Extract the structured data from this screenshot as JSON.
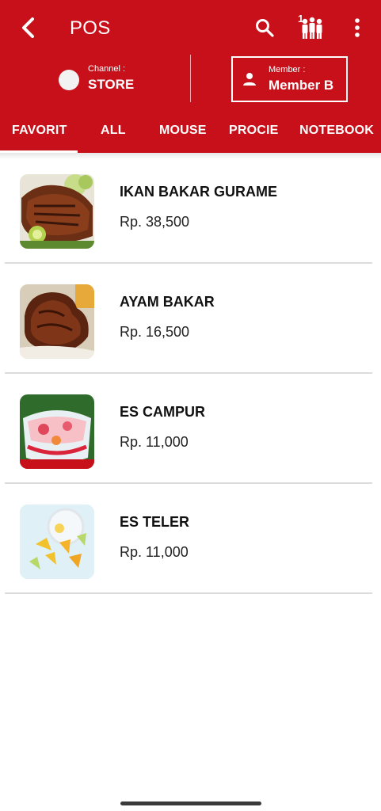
{
  "header": {
    "title": "POS",
    "queue_count": "1"
  },
  "channel": {
    "label": "Channel :",
    "value": "STORE"
  },
  "member": {
    "label": "Member :",
    "value": "Member B"
  },
  "tabs": [
    {
      "label": "FAVORIT",
      "active": true
    },
    {
      "label": "ALL",
      "active": false
    },
    {
      "label": "MOUSE",
      "active": false
    },
    {
      "label": "PROCIE",
      "active": false
    },
    {
      "label": "NOTEBOOK",
      "active": false
    }
  ],
  "products": [
    {
      "name": "IKAN BAKAR GURAME",
      "price": "Rp. 38,500"
    },
    {
      "name": "AYAM BAKAR",
      "price": "Rp. 16,500"
    },
    {
      "name": "ES CAMPUR",
      "price": "Rp. 11,000"
    },
    {
      "name": "ES TELER",
      "price": "Rp. 11,000"
    }
  ],
  "colors": {
    "primary": "#c8101a",
    "divider": "#dcdcdc"
  }
}
